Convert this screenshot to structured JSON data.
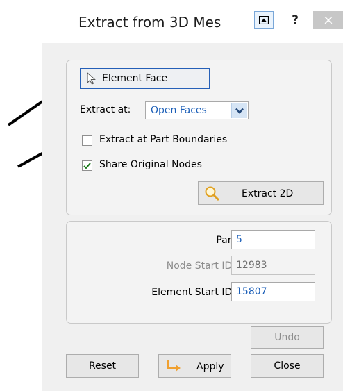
{
  "dialog": {
    "title": "Extract from 3D Mes",
    "titlebar_buttons": {
      "pin_icon": "dock-icon",
      "help": "?",
      "close": "×"
    }
  },
  "extract": {
    "element_face_label": "Element Face",
    "extract_at_label": "Extract at:",
    "extract_at_value": "Open Faces",
    "part_boundaries": {
      "label": "Extract at Part Boundaries",
      "checked": false
    },
    "share_nodes": {
      "label": "Share Original Nodes",
      "checked": true
    },
    "extract2d_label": "Extract 2D"
  },
  "ids": {
    "part_label": "Part",
    "part_value": "5",
    "node_start_label": "Node Start ID:",
    "node_start_value": "12983",
    "element_start_label": "Element Start ID:",
    "element_start_value": "15807"
  },
  "footer": {
    "undo_label": "Undo",
    "reset_label": "Reset",
    "apply_label": "Apply",
    "close_label": "Close"
  },
  "colors": {
    "accent": "#2660b8",
    "link_blue": "#1c5fb8",
    "apply_icon": "#f0a030"
  }
}
